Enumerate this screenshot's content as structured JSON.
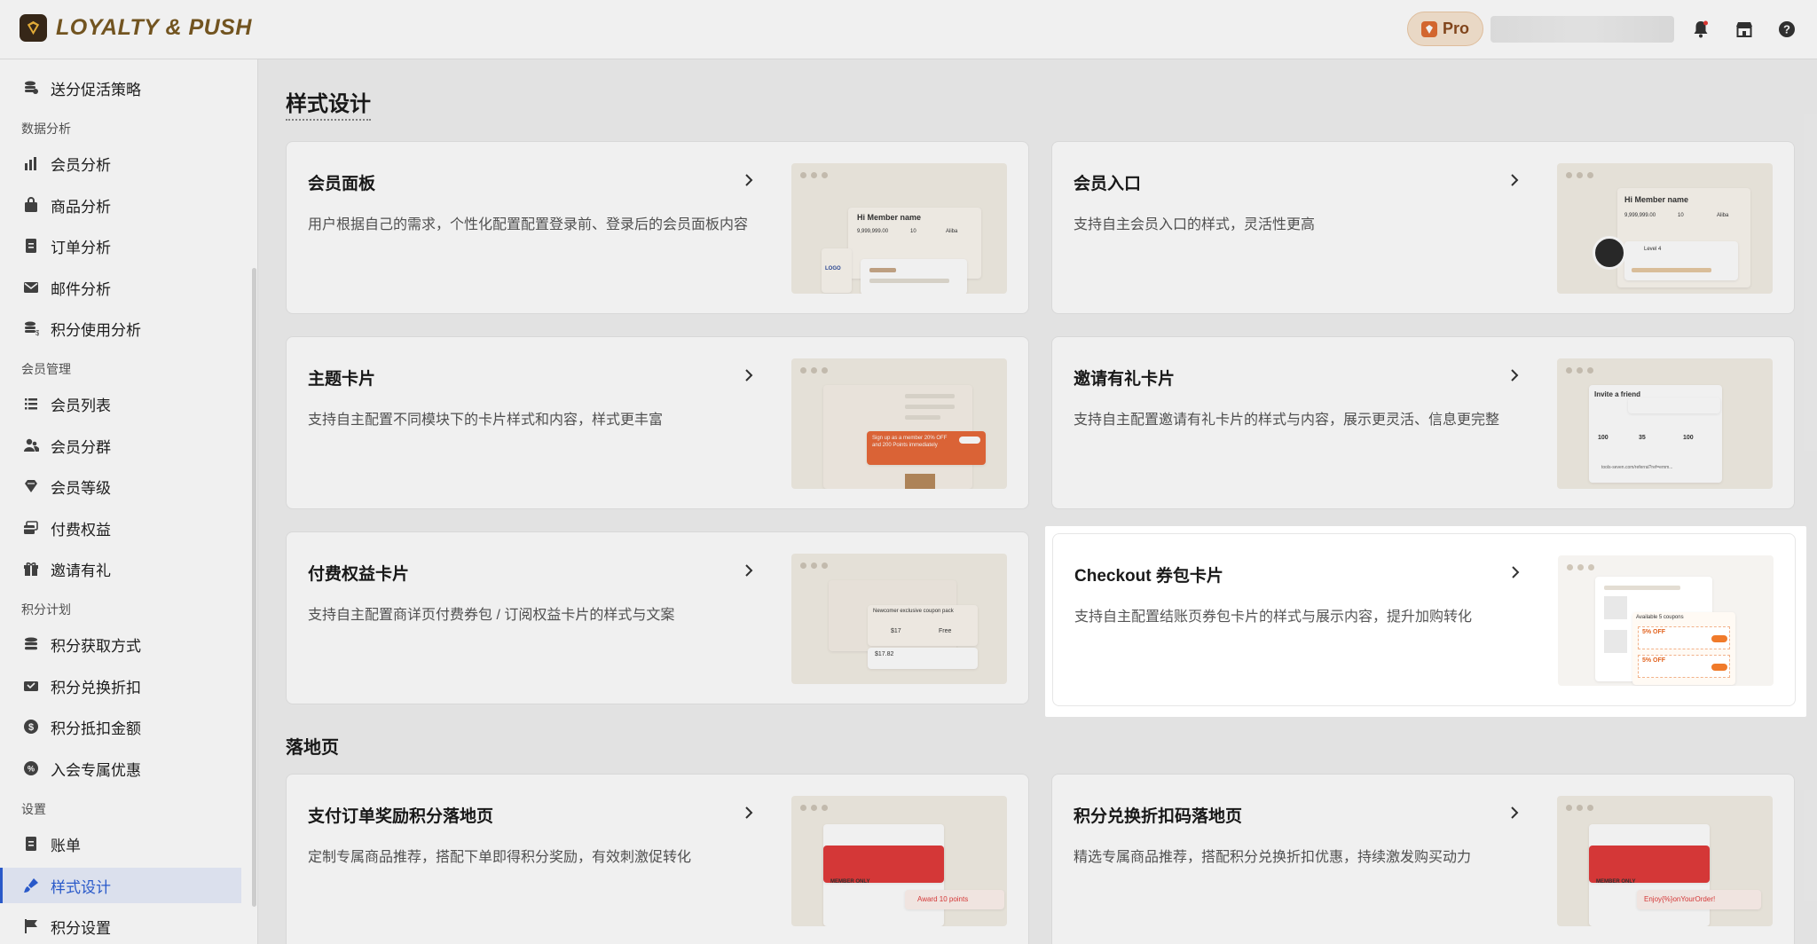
{
  "brand": {
    "name": "LOYALTY & PUSH"
  },
  "topbar": {
    "pro_label": "Pro"
  },
  "sidebar": {
    "top_item": "送分促活策略",
    "groups": [
      {
        "label": "数据分析",
        "items": [
          "会员分析",
          "商品分析",
          "订单分析",
          "邮件分析",
          "积分使用分析"
        ]
      },
      {
        "label": "会员管理",
        "items": [
          "会员列表",
          "会员分群",
          "会员等级",
          "付费权益",
          "邀请有礼"
        ]
      },
      {
        "label": "积分计划",
        "items": [
          "积分获取方式",
          "积分兑换折扣",
          "积分抵扣金额",
          "入会专属优惠"
        ]
      },
      {
        "label": "设置",
        "items": [
          "账单",
          "样式设计",
          "积分设置"
        ]
      }
    ],
    "active_item": "样式设计"
  },
  "main": {
    "section_style": "样式设计",
    "section_landing": "落地页",
    "cards": [
      {
        "title": "会员面板",
        "desc": "用户根据自己的需求，个性化配置配置登录前、登录后的会员面板内容"
      },
      {
        "title": "会员入口",
        "desc": "支持自主会员入口的样式，灵活性更高"
      },
      {
        "title": "主题卡片",
        "desc": "支持自主配置不同模块下的卡片样式和内容，样式更丰富"
      },
      {
        "title": "邀请有礼卡片",
        "desc": "支持自主配置邀请有礼卡片的样式与内容，展示更灵活、信息更完整"
      },
      {
        "title": "付费权益卡片",
        "desc": "支持自主配置商详页付费券包 / 订阅权益卡片的样式与文案"
      },
      {
        "title": "Checkout 券包卡片",
        "desc": "支持自主配置结账页券包卡片的样式与展示内容，提升加购转化"
      },
      {
        "title": "支付订单奖励积分落地页",
        "desc": "定制专属商品推荐，搭配下单即得积分奖励，有效刺激促转化"
      },
      {
        "title": "积分兑换折扣码落地页",
        "desc": "精选专属商品推荐，搭配积分兑换折扣优惠，持续激发购买动力"
      }
    ]
  },
  "thumbs": {
    "member_name": "Hi Member name",
    "points_value": "9,999,999.00",
    "coupons_value": "10",
    "tier_name": "Aliba",
    "logo": "LOGO",
    "level": "Level 4",
    "invite_title": "Invite a friend",
    "invite_points": "100",
    "invite_off": "35",
    "invite_points2": "100",
    "invite_link": "tools-seven.com/referral?ref=emm...",
    "newcomer": "Newcomer exclusive coupon pack",
    "price1": "$17",
    "price2": "$17.82",
    "free": "Free",
    "available": "Available 5 coupons",
    "off": "5% OFF",
    "member_only": "MEMBER ONLY",
    "award": "Award 10 points",
    "enjoy": "Enjoy{%}onYourOrder!",
    "signup": "Sign up as a member 20% OFF and 200 Points immediately"
  }
}
